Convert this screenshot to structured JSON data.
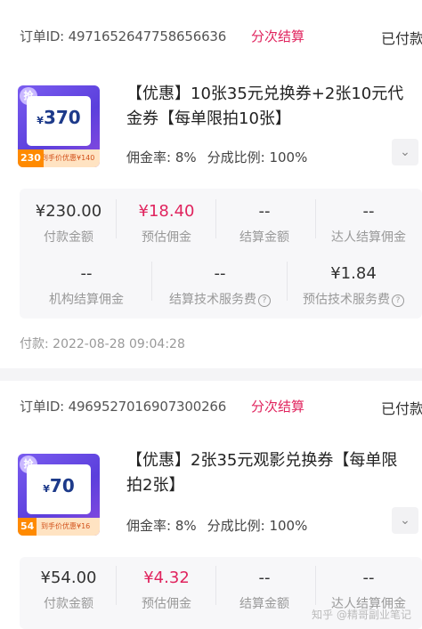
{
  "orders": [
    {
      "order_id": "订单ID: 4971652647758656636",
      "split_tag": "分次结算",
      "status": "已付款",
      "thumb": {
        "badge": "抢",
        "price_symbol": "¥",
        "price": "370",
        "corner": "230",
        "ribbon": "到手价优惠¥140"
      },
      "title": "【优惠】10张35元兑换券+2张10元代金券【每单限拍10张】",
      "commission_rate": "佣金率: 8%",
      "split_ratio": "分成比例: 100%",
      "expand_icon": "chevron-down-icon",
      "stats": [
        {
          "value": "¥230.00",
          "label": "付款金额"
        },
        {
          "value": "¥18.40",
          "label": "预估佣金"
        },
        {
          "value": "--",
          "label": "结算金额"
        },
        {
          "value": "--",
          "label": "达人结算佣金"
        },
        {
          "value": "--",
          "label": "机构结算佣金"
        },
        {
          "value": "--",
          "label": "结算技术服务费"
        },
        {
          "value": "¥1.84",
          "label": "预估技术服务费"
        }
      ],
      "pay_time": "付款: 2022-08-28 09:04:28"
    },
    {
      "order_id": "订单ID: 4969527016907300266",
      "split_tag": "分次结算",
      "status": "已付款",
      "thumb": {
        "badge": "抢",
        "price_symbol": "¥",
        "price": "70",
        "corner": "54",
        "ribbon": "到手价优惠¥16"
      },
      "title": "【优惠】2张35元观影兑换券【每单限拍2张】",
      "commission_rate": "佣金率: 8%",
      "split_ratio": "分成比例: 100%",
      "expand_icon": "chevron-down-icon",
      "stats": [
        {
          "value": "¥54.00",
          "label": "付款金额"
        },
        {
          "value": "¥4.32",
          "label": "预估佣金"
        },
        {
          "value": "--",
          "label": "结算金额"
        },
        {
          "value": "--",
          "label": "达人结算佣金"
        }
      ]
    }
  ],
  "watermark": "知乎 @精哥副业笔记",
  "colors": {
    "accent": "#e0245e",
    "thumb_bg": "#6a4de8",
    "stats_bg": "#f7f7f9"
  }
}
